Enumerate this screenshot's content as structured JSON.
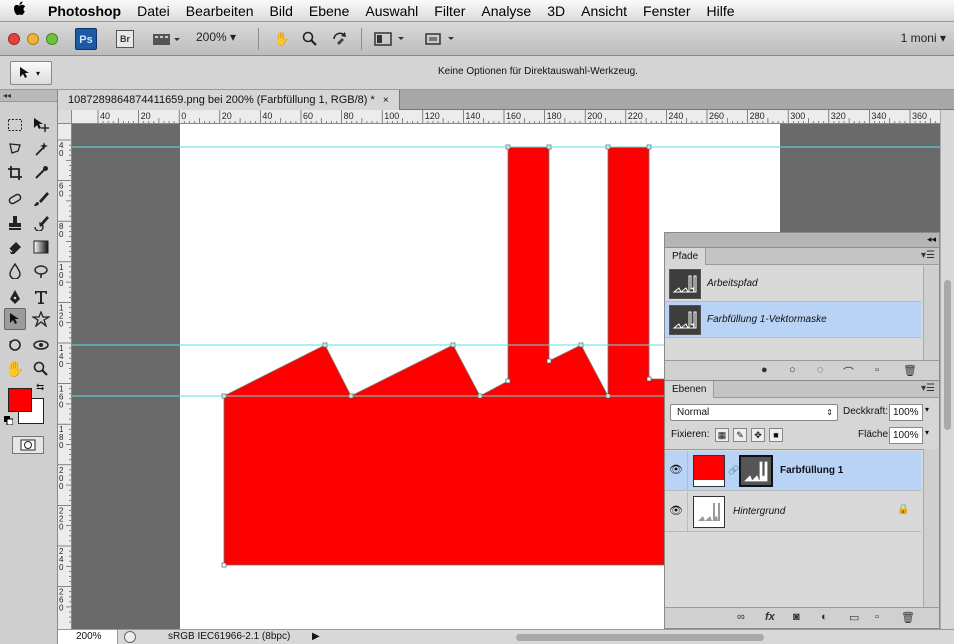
{
  "menubar": {
    "apple": "",
    "app": "Photoshop",
    "items": [
      "Datei",
      "Bearbeiten",
      "Bild",
      "Ebene",
      "Auswahl",
      "Filter",
      "Analyse",
      "3D",
      "Ansicht",
      "Fenster",
      "Hilfe"
    ]
  },
  "appbar": {
    "ps": "Ps",
    "br": "Br",
    "zoom": "200%",
    "workspace": "1 moni"
  },
  "options": {
    "hint": "Keine Optionen für Direktauswahl-Werkzeug."
  },
  "document": {
    "tab_title": "1087289864874411659.png bei 200% (Farbfüllung 1, RGB/8) *",
    "close": "×"
  },
  "rulers": {
    "top": [
      "40",
      "20",
      "0",
      "20",
      "40",
      "60",
      "80",
      "100",
      "120",
      "140",
      "160",
      "180",
      "200",
      "220",
      "240",
      "260",
      "280",
      "300",
      "320",
      "340",
      "360"
    ],
    "left": [
      "4 0",
      "6 0",
      "8 0",
      "1 0 0",
      "1 2 0",
      "1 4 0",
      "1 6 0",
      "1 8 0",
      "2 0 0",
      "2 2 0",
      "2 4 0",
      "2 6 0"
    ]
  },
  "status": {
    "zoom": "200%",
    "profile": "sRGB IEC61966-2.1 (8bpc)"
  },
  "colors": {
    "foreground": "#ff0000",
    "background": "#ffffff",
    "guide": "#5ce0e0",
    "fill": "#ff0000"
  },
  "paths_panel": {
    "tab": "Pfade",
    "items": [
      {
        "label": "Arbeitspfad"
      },
      {
        "label": "Farbfüllung 1-Vektormaske"
      }
    ]
  },
  "layers_panel": {
    "tab": "Ebenen",
    "blend_mode": "Normal",
    "opacity_label": "Deckkraft:",
    "opacity": "100%",
    "lock_label": "Fixieren:",
    "fill_label": "Fläche:",
    "fill": "100%",
    "layers": [
      {
        "name": "Farbfüllung 1"
      },
      {
        "name": "Hintergrund"
      }
    ]
  }
}
